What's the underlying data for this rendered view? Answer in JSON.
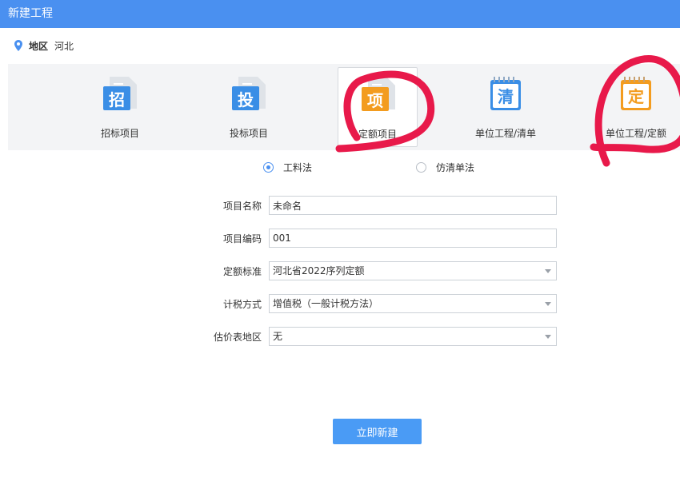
{
  "dialog": {
    "title": "新建工程"
  },
  "region": {
    "label": "地区",
    "value": "河北",
    "icon": "location-pin-icon"
  },
  "project_types": [
    {
      "id": "bid",
      "glyph": "招",
      "label": "招标项目",
      "color": "#3a8ee6",
      "selected": false
    },
    {
      "id": "tender",
      "glyph": "投",
      "label": "投标项目",
      "color": "#3a8ee6",
      "selected": false
    },
    {
      "id": "quota",
      "glyph": "项",
      "label": "定额项目",
      "color": "#f39c1f",
      "selected": true
    },
    {
      "id": "unit-list",
      "glyph": "清",
      "label": "单位工程/清单",
      "color": "#3a8ee6",
      "selected": false
    },
    {
      "id": "unit-quota",
      "glyph": "定",
      "label": "单位工程/定额",
      "color": "#f39c1f",
      "selected": false
    }
  ],
  "methods": [
    {
      "label": "工料法",
      "checked": true
    },
    {
      "label": "仿清单法",
      "checked": false
    }
  ],
  "form": {
    "name": {
      "label": "项目名称",
      "value": "未命名"
    },
    "code": {
      "label": "项目编码",
      "value": "001"
    },
    "standard": {
      "label": "定额标准",
      "value": "河北省2022序列定额"
    },
    "tax": {
      "label": "计税方式",
      "value": "增值税（一般计税方法）"
    },
    "estimate_region": {
      "label": "估价表地区",
      "value": "无"
    }
  },
  "actions": {
    "create_label": "立即新建"
  },
  "colors": {
    "accent": "#4a90f0",
    "annotation": "#e8194a",
    "orange": "#f39c1f"
  }
}
